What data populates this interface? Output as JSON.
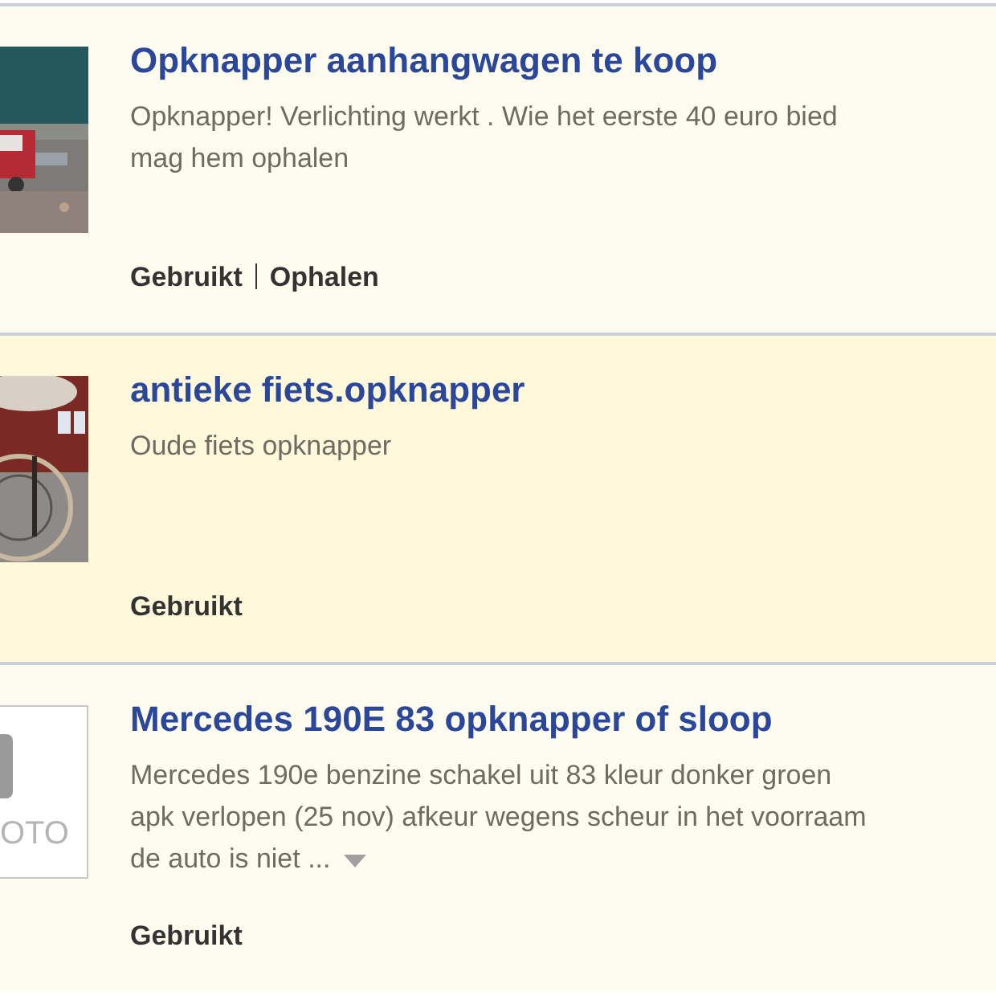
{
  "listings": [
    {
      "title": "Opknapper aanhangwagen te koop",
      "description": "Opknapper! Verlichting werkt . Wie het eerste 40 euro bied mag hem ophalen",
      "highlighted": false,
      "thumbnail": {
        "kind": "picture"
      },
      "tags": [
        "Gebruikt",
        "Ophalen"
      ],
      "more": false
    },
    {
      "title": "antieke fiets.opknapper",
      "description": "Oude fiets opknapper",
      "highlighted": true,
      "thumbnail": {
        "kind": "picture"
      },
      "tags": [
        "Gebruikt"
      ],
      "more": false
    },
    {
      "title": "Mercedes 190E 83 opknapper of sloop",
      "description": "Mercedes 190e benzine schakel uit 83 kleur donker groen apk verlopen (25 nov) afkeur wegens scheur in het voorraam de auto is niet ...",
      "highlighted": false,
      "thumbnail": {
        "kind": "placeholder",
        "label": "OTO"
      },
      "tags": [
        "Gebruikt"
      ],
      "more": true
    }
  ]
}
